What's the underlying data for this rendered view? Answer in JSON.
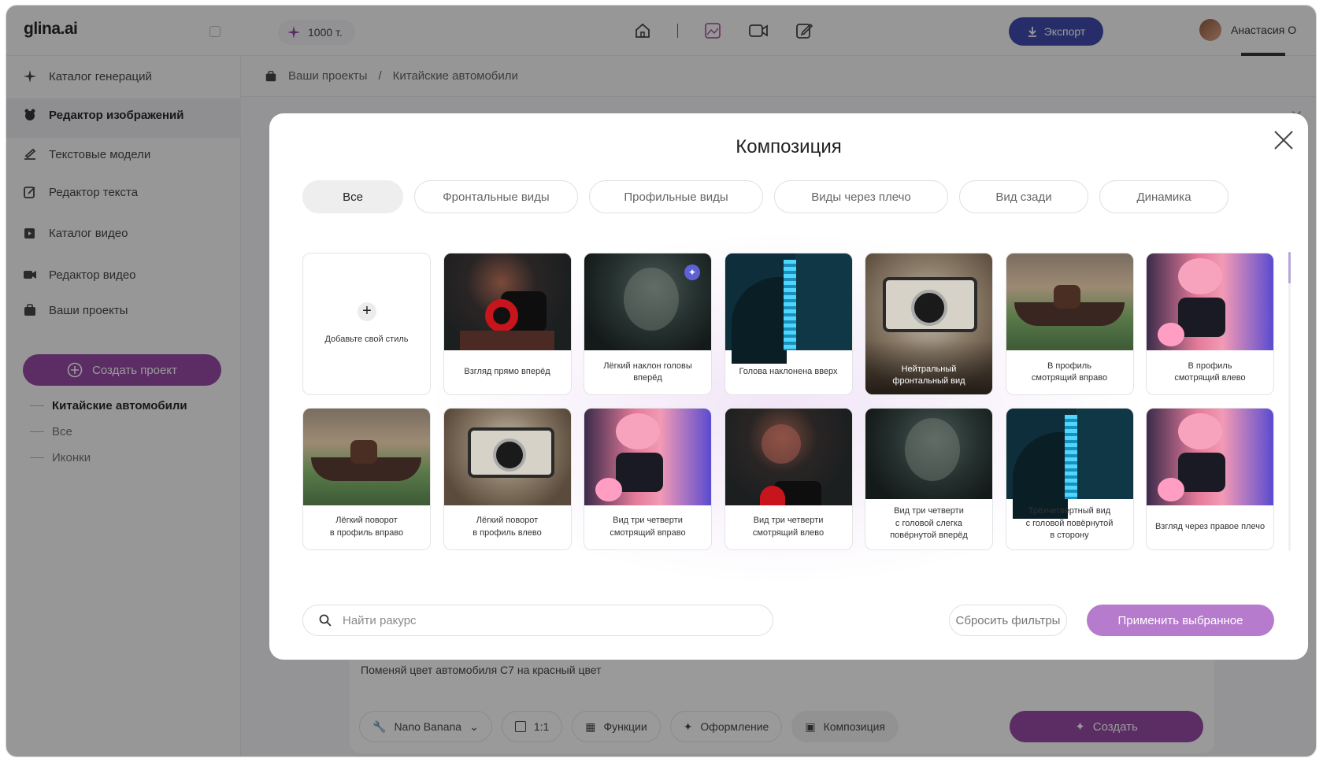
{
  "app": {
    "logo": "glina.ai",
    "tokens": "1000 т.",
    "export_label": "Экспорт",
    "user_name": "Анастасия О"
  },
  "sidebar": {
    "items": [
      {
        "label": "Каталог генераций",
        "icon": "sparkle-icon"
      },
      {
        "label": "Редактор изображений",
        "icon": "image-edit-icon"
      },
      {
        "label": "Текстовые модели",
        "icon": "text-model-icon"
      },
      {
        "label": "Редактор текста",
        "icon": "edit-doc-icon"
      },
      {
        "label": "Каталог видео",
        "icon": "video-catalog-icon"
      },
      {
        "label": "Редактор видео",
        "icon": "video-icon"
      },
      {
        "label": "Ваши проекты",
        "icon": "briefcase-icon"
      }
    ],
    "create_project": "Создать проект",
    "projects": [
      "Китайские автомобили",
      "Все",
      "Иконки"
    ]
  },
  "breadcrumb": {
    "root": "Ваши проекты",
    "sep": "/",
    "current": "Китайские автомобили"
  },
  "prompt": {
    "text": "Поменяй цвет автомобиля С7 на красный цвет",
    "model": "Nano Banana",
    "ratio": "1:1",
    "functions": "Функции",
    "styling": "Оформление",
    "composition": "Композиция",
    "create": "Создать"
  },
  "modal": {
    "title": "Композиция",
    "filters": [
      "Все",
      "Фронтальные виды",
      "Профильные виды",
      "Виды через плечо",
      "Вид сзади",
      "Динамика"
    ],
    "active_filter": "Все",
    "add_style": "Добавьте свой стиль",
    "cards": [
      {
        "label": "Взгляд прямо вперёд",
        "thumb": "camred"
      },
      {
        "label": "Лёгкий наклон головы\nвперёд",
        "thumb": "dark"
      },
      {
        "label": "Голова наклонена вверх",
        "thumb": "building"
      },
      {
        "label": "Нейтральный\nфронтальный вид",
        "thumb": "camvint"
      },
      {
        "label": "В профиль\nсмотрящий вправо",
        "thumb": "gondola"
      },
      {
        "label": "В профиль\nсмотрящий влево",
        "thumb": "kirby"
      },
      {
        "label": "Лёгкий поворот\nв профиль вправо",
        "thumb": "gondola"
      },
      {
        "label": "Лёгкий поворот\nв профиль влево",
        "thumb": "camvint"
      },
      {
        "label": "Вид три четверти\nсмотрящий вправо",
        "thumb": "kirby"
      },
      {
        "label": "Вид три четверти\nсмотрящий влево",
        "thumb": "camred"
      },
      {
        "label": "Вид три четверти\nс головой слегка\nповёрнутой вперёд",
        "thumb": "dark"
      },
      {
        "label": "Трёхчетвертный вид\nс головой повёрнутой\nв сторону",
        "thumb": "building"
      },
      {
        "label": "Взгляд через правое плечо",
        "thumb": "kirby"
      }
    ],
    "search_placeholder": "Найти ракурс",
    "reset": "Сбросить фильтры",
    "apply": "Применить выбранное"
  },
  "colors": {
    "accent": "#8c3a9c",
    "apply": "#b67bcc",
    "export": "#2f3aa3",
    "badge": "#5e60d6"
  }
}
